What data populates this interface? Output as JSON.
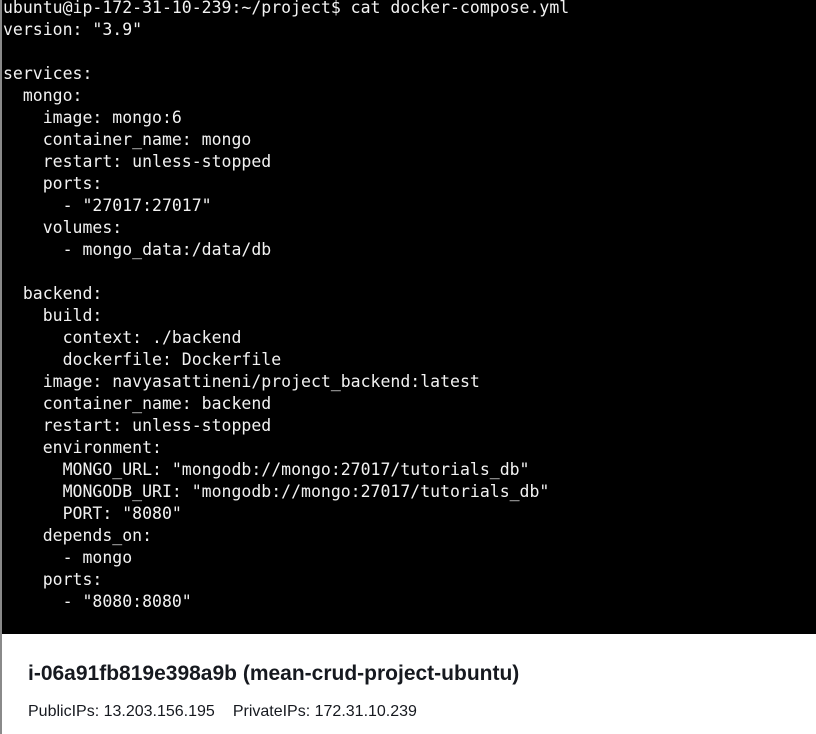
{
  "terminal": {
    "lines": [
      "ubuntu@ip-172-31-10-239:~/project$ cat docker-compose.yml",
      "version: \"3.9\"",
      "",
      "services:",
      "  mongo:",
      "    image: mongo:6",
      "    container_name: mongo",
      "    restart: unless-stopped",
      "    ports:",
      "      - \"27017:27017\"",
      "    volumes:",
      "      - mongo_data:/data/db",
      "",
      "  backend:",
      "    build:",
      "      context: ./backend",
      "      dockerfile: Dockerfile",
      "    image: navyasattineni/project_backend:latest",
      "    container_name: backend",
      "    restart: unless-stopped",
      "    environment:",
      "      MONGO_URL: \"mongodb://mongo:27017/tutorials_db\"",
      "      MONGODB_URI: \"mongodb://mongo:27017/tutorials_db\"",
      "      PORT: \"8080\"",
      "    depends_on:",
      "      - mongo",
      "    ports:",
      "      - \"8080:8080\""
    ]
  },
  "instance": {
    "title": "i-06a91fb819e398a9b (mean-crud-project-ubuntu)",
    "public_ips_label": "PublicIPs:",
    "public_ips_value": "13.203.156.195",
    "private_ips_label": "PrivateIPs:",
    "private_ips_value": "172.31.10.239"
  }
}
